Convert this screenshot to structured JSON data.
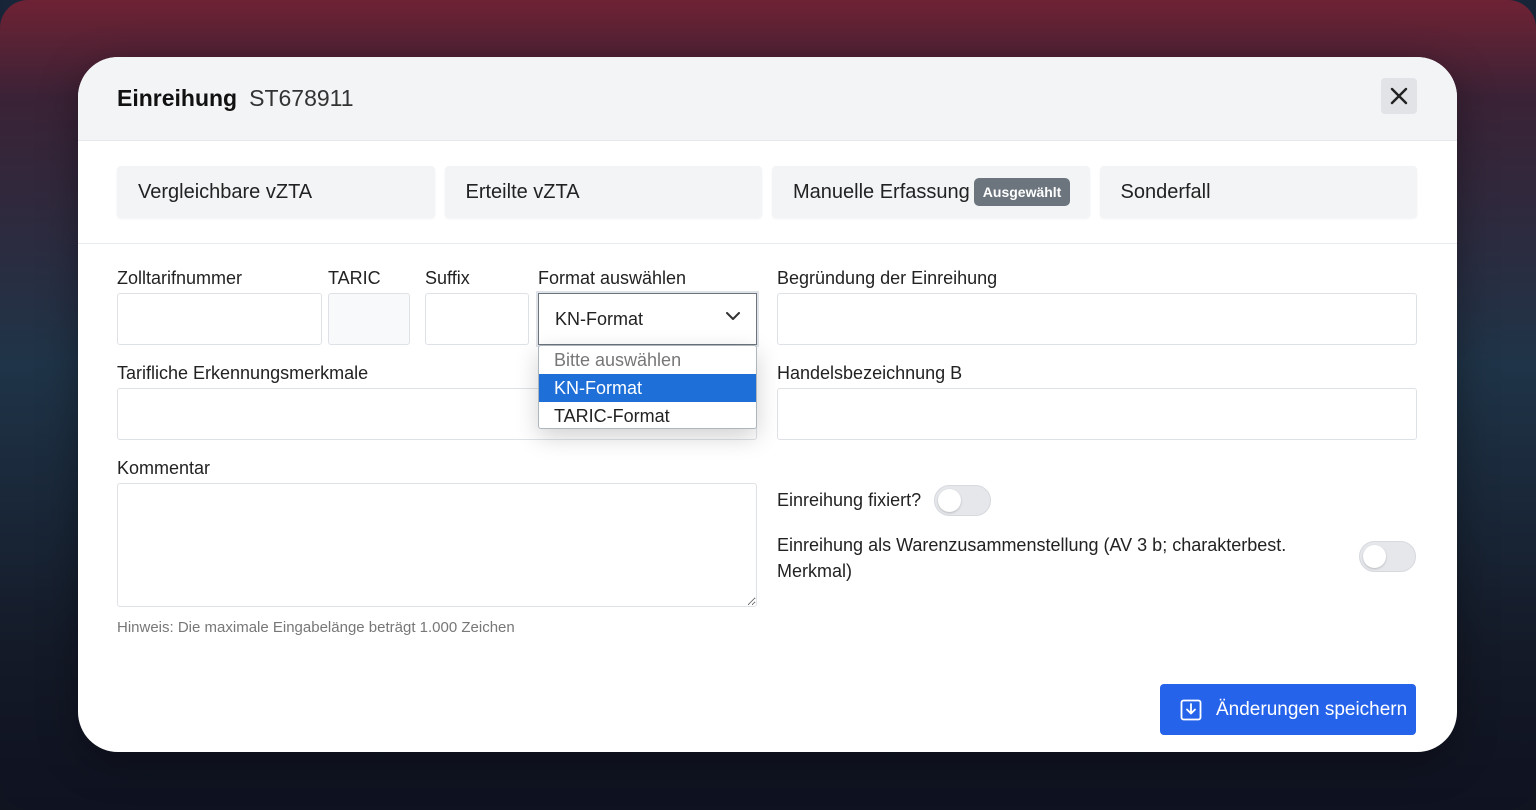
{
  "modal": {
    "title": "Einreihung",
    "id": "ST678911"
  },
  "tabs": [
    {
      "label": "Vergleichbare vZTA"
    },
    {
      "label": "Erteilte vZTA"
    },
    {
      "label": "Manuelle Erfassung",
      "badge": "Ausgewählt"
    },
    {
      "label": "Sonderfall"
    }
  ],
  "form": {
    "zolltarifnummer_label": "Zolltarifnummer",
    "taric_label": "TARIC",
    "suffix_label": "Suffix",
    "format_label": "Format auswählen",
    "format_value": "KN-Format",
    "format_options": [
      "Bitte auswählen",
      "KN-Format",
      "TARIC-Format"
    ],
    "begruendung_label": "Begründung der Einreihung",
    "merkmale_label": "Tarifliche Erkennungsmerkmale",
    "handelsbezeichnung_label": "Handelsbezeichnung B",
    "kommentar_label": "Kommentar",
    "fixiert_label": "Einreihung fixiert?",
    "warenzusammenstellung_label_1": "Einreihung als Warenzusammenstellung (AV 3 b; charakterbest.",
    "warenzusammenstellung_label_2": "Merkmal)",
    "hint": "Hinweis: Die maximale Eingabelänge beträgt 1.000 Zeichen"
  },
  "footer": {
    "save_label": "Änderungen speichern"
  },
  "colors": {
    "primary": "#2563eb",
    "selected_option": "#1f6fd8",
    "badge": "#6c757d"
  }
}
